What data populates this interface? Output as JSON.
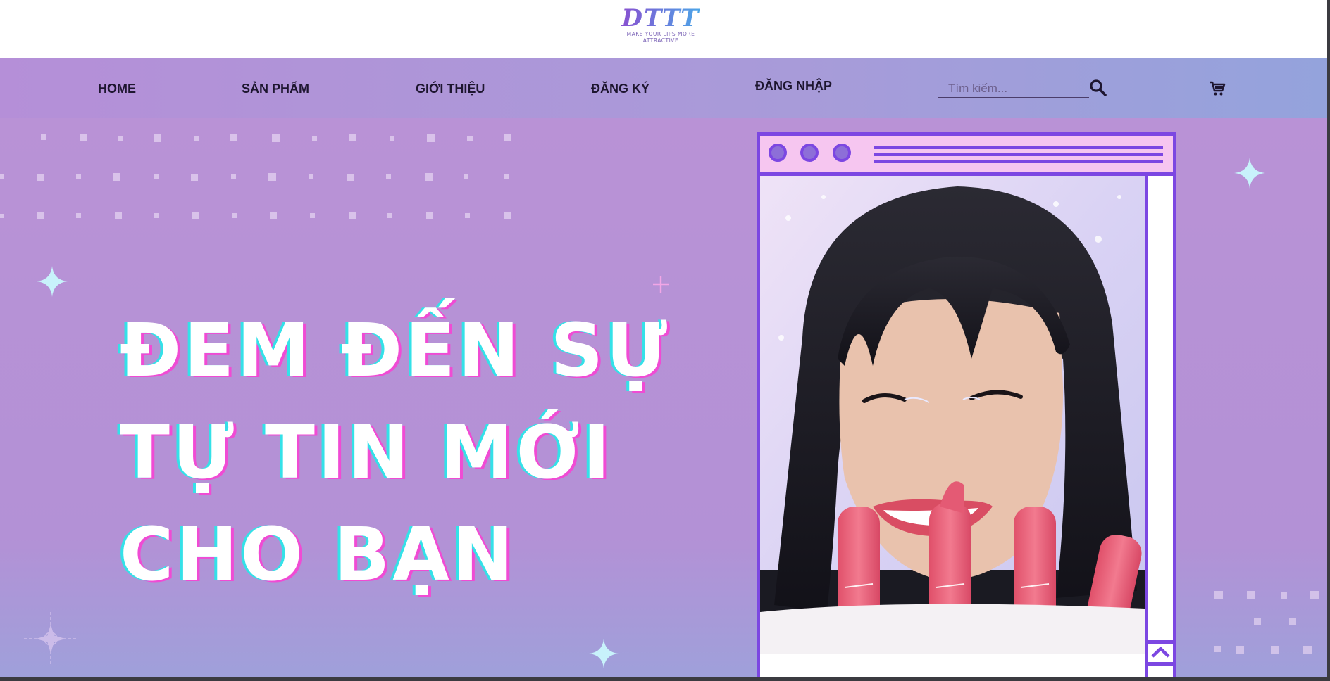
{
  "brand": {
    "logo_text": "DTTT",
    "tagline_line1": "MAKE YOUR LIPS MORE",
    "tagline_line2": "ATTRACTIVE"
  },
  "nav": {
    "items": [
      {
        "label": "HOME"
      },
      {
        "label": "SẢN PHẨM"
      },
      {
        "label": "GIỚI THIỆU"
      },
      {
        "label": "ĐĂNG KÝ"
      },
      {
        "label": "ĐĂNG NHẬP"
      }
    ],
    "search_placeholder": "Tìm kiếm...",
    "search_icon": "search-icon",
    "cart_icon": "cart-icon"
  },
  "hero": {
    "headline": [
      "ĐEM ĐẾN SỰ",
      "TỰ TIN MỚI",
      "CHO BẠN"
    ],
    "image_alt": "Model holding four pink lipsticks",
    "window_icons": [
      "window-dot-icon",
      "window-dot-icon",
      "window-dot-icon",
      "scroll-up-icon"
    ]
  },
  "colors": {
    "accent_purple": "#7c47e2",
    "hero_bg": "#b992d6",
    "headline_fill": "#ffffff",
    "headline_shadow_cyan": "#34e1e8",
    "headline_shadow_pink": "#f04bd4"
  }
}
